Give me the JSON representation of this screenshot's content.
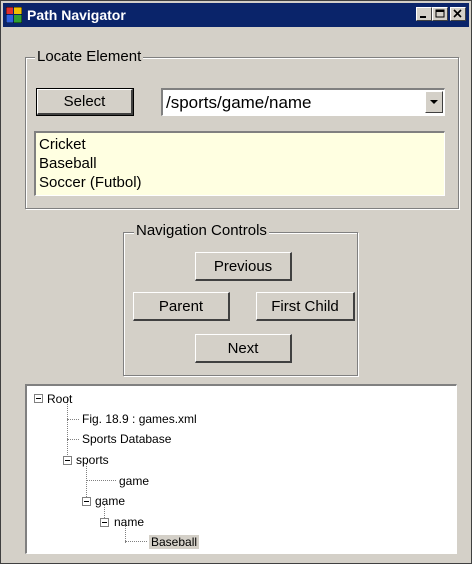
{
  "window": {
    "title": "Path Navigator"
  },
  "locate": {
    "legend": "Locate Element",
    "select_label": "Select",
    "path_value": "/sports/game/name",
    "results": [
      "Cricket",
      "Baseball",
      "Soccer (Futbol)"
    ]
  },
  "nav": {
    "legend": "Navigation Controls",
    "previous_label": "Previous",
    "parent_label": "Parent",
    "first_child_label": "First Child",
    "next_label": "Next"
  },
  "tree": {
    "root": "Root",
    "fig": "Fig. 18.9 : games.xml",
    "db": "Sports Database",
    "sports": "sports",
    "game1": "game",
    "game2": "game",
    "name": "name",
    "leaf": "Baseball"
  },
  "colors": {
    "titlebar": "#0a246a",
    "face": "#d4d0c8",
    "listbox": "#ffffe1"
  }
}
